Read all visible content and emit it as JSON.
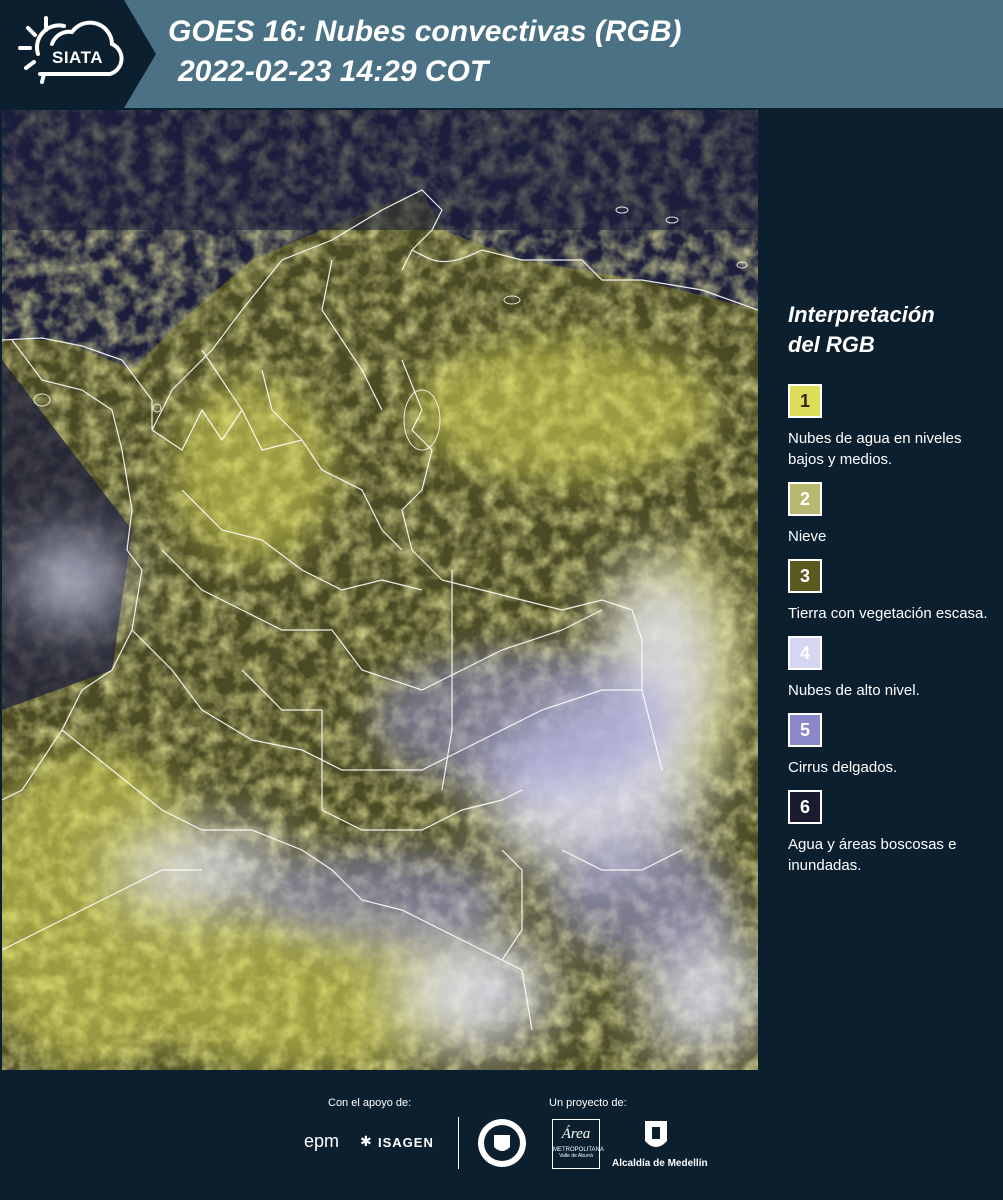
{
  "header": {
    "brand": "SIATA",
    "title": "GOES 16: Nubes convectivas (RGB)",
    "subtitle": "2022-02-23 14:29 COT",
    "colors": {
      "bar": "#4a7284",
      "dark": "#0b1f2e"
    }
  },
  "legend": {
    "title_line1": "Interpretación",
    "title_line2": "del RGB",
    "items": [
      {
        "num": "1",
        "color": "#dede5a",
        "text": "Nubes de agua en niveles bajos y medios."
      },
      {
        "num": "2",
        "color": "#b8b870",
        "text": "Nieve"
      },
      {
        "num": "3",
        "color": "#5a5a1e",
        "text": "Tierra con vegetación escasa."
      },
      {
        "num": "4",
        "color": "#d6d6f2",
        "text": "Nubes de alto nivel."
      },
      {
        "num": "5",
        "color": "#8a88c8",
        "text": "Cirrus delgados."
      },
      {
        "num": "6",
        "color": "#1a1a30",
        "text": "Agua y áreas boscosas e inundadas."
      }
    ]
  },
  "footer": {
    "support_label": "Con el apoyo de:",
    "project_label": "Un proyecto de:",
    "logo_epm": "epm",
    "logo_isagen": "ISAGEN",
    "logo_area_line1": "Área",
    "logo_area_line2": "METROPOLITANA",
    "logo_area_line3": "Valle de Aburrá",
    "logo_alcaldia": "Alcaldía de Medellín"
  }
}
